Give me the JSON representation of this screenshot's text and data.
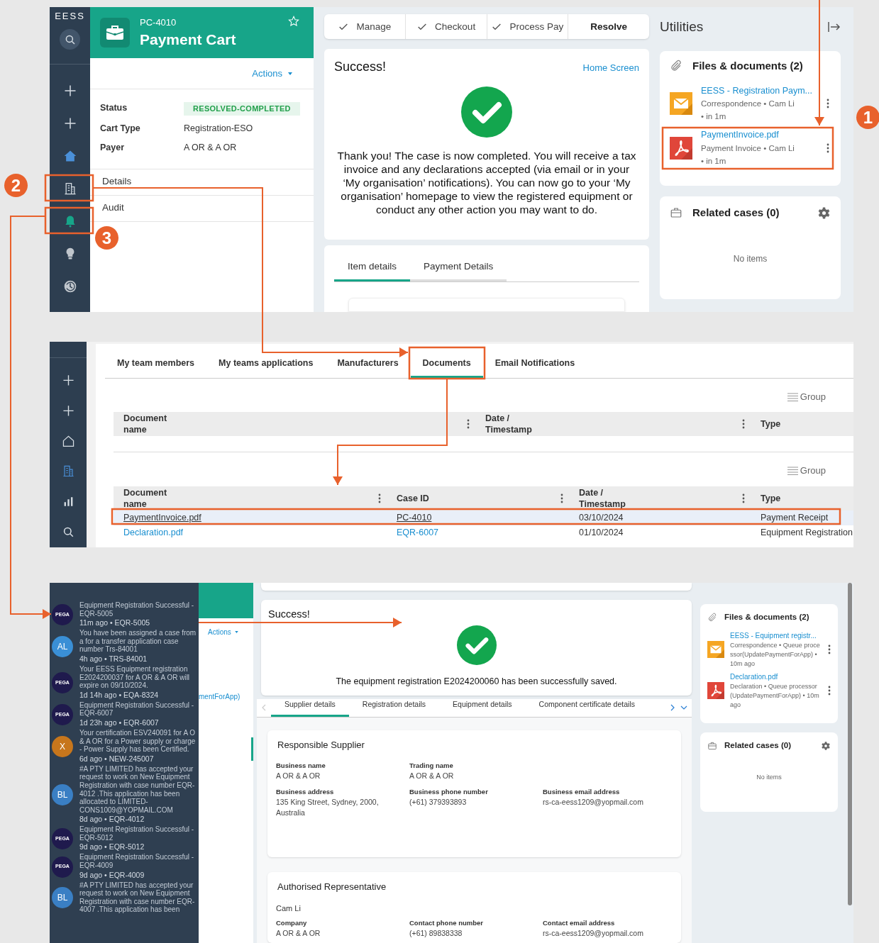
{
  "callouts": [
    "1",
    "2",
    "3"
  ],
  "case_screen": {
    "logo": "EESS",
    "nav": [
      {
        "kind": "search",
        "selected": false
      },
      {
        "kind": "plus",
        "selected": false
      },
      {
        "kind": "plus",
        "selected": false
      },
      {
        "kind": "home",
        "selected": true
      },
      {
        "kind": "building",
        "selected": false
      },
      {
        "kind": "bell",
        "selected": false
      },
      {
        "kind": "bulb",
        "selected": false
      },
      {
        "kind": "history",
        "selected": false
      }
    ],
    "header": {
      "case_id": "PC-4010",
      "title": "Payment Cart"
    },
    "actions": "Actions",
    "fields": [
      {
        "label": "Status",
        "value": "RESOLVED-COMPLETED",
        "kind": "badge"
      },
      {
        "label": "Cart Type",
        "value": "Registration-ESO",
        "kind": "text"
      },
      {
        "label": "Payer",
        "value": "A OR & A OR",
        "kind": "text"
      }
    ],
    "menu": [
      "Details",
      "Audit"
    ],
    "stages": [
      {
        "label": "Manage",
        "done": true
      },
      {
        "label": "Checkout",
        "done": true
      },
      {
        "label": "Process Pay",
        "done": true
      },
      {
        "label": "Resolve",
        "done": false
      }
    ],
    "success": {
      "title": "Success!",
      "link": "Home Screen",
      "message": "Thank you! The case is now completed. You will receive a tax invoice and any declarations accepted (via email or in your ‘My organisation’ notifications). You can now go to your ‘My organisation’ homepage to view the registered equipment or conduct any other action you may want to do."
    },
    "tabs": [
      {
        "label": "Item details",
        "selected": true
      },
      {
        "label": "Payment Details",
        "selected": false
      }
    ],
    "utilities": {
      "title": "Utilities",
      "files_title": "Files & documents (2)",
      "files": [
        {
          "kind": "mail",
          "name": "EESS - Registration Paym...",
          "meta": "Correspondence • Cam Li • in 1m"
        },
        {
          "kind": "pdf",
          "name": "PaymentInvoice.pdf",
          "meta": "Payment Invoice • Cam Li • in 1m"
        }
      ],
      "related_title": "Related cases (0)",
      "empty": "No items"
    }
  },
  "team_screen": {
    "nav": [
      {
        "kind": "plus",
        "selected": false
      },
      {
        "kind": "plus",
        "selected": false
      },
      {
        "kind": "home",
        "selected": false
      },
      {
        "kind": "building",
        "selected": true
      },
      {
        "kind": "chart",
        "selected": false
      },
      {
        "kind": "search",
        "selected": false
      }
    ],
    "tabs": [
      {
        "label": "My team members",
        "selected": false
      },
      {
        "label": "My teams applications",
        "selected": false
      },
      {
        "label": "Manufacturers",
        "selected": false
      },
      {
        "label": "Documents",
        "selected": true
      },
      {
        "label": "Email Notifications",
        "selected": false
      }
    ],
    "documents_table": {
      "group": "Group",
      "columns": [
        "Document name",
        "Date / Timestamp",
        "Type"
      ]
    },
    "case_documents_table": {
      "group": "Group",
      "columns": [
        "Document name",
        "Case ID",
        "Date / Timestamp",
        "Type"
      ],
      "rows": [
        {
          "selected": true,
          "cells": [
            "PaymentInvoice.pdf",
            "PC-4010",
            "03/10/2024",
            "Payment Receipt"
          ]
        },
        {
          "selected": false,
          "cells": [
            "Declaration.pdf",
            "EQR-6007",
            "01/10/2024",
            "Equipment Registration"
          ]
        }
      ]
    }
  },
  "registration_screen": {
    "notifications": [
      {
        "avatar": "PEGA",
        "color": "#1f1a4d",
        "text": "Equipment Registration Successful - EQR-5005",
        "time": "11m ago • EQR-5005"
      },
      {
        "avatar": "AL",
        "color": "#3a8fd6",
        "text": "You have been assigned a case from a for a transfer application case number Trs-84001",
        "time": "4h ago • TRS-84001"
      },
      {
        "avatar": "PEGA",
        "color": "#1f1a4d",
        "text": "Your EESS Equipment registration E2024200037 for A OR & A OR will expire on 09/10/2024.",
        "time": "1d 14h ago • EQA-8324"
      },
      {
        "avatar": "PEGA",
        "color": "#1f1a4d",
        "text": "Equipment Registration Successful - EQR-6007",
        "time": "1d 23h ago • EQR-6007"
      },
      {
        "avatar": "X",
        "color": "#c7761c",
        "text": "Your certification ESV240091 for A O & A OR for a Power supply or charge - Power Supply has been Certified.",
        "time": "6d ago • NEW-245007"
      },
      {
        "avatar": "BL",
        "color": "#3a7fc4",
        "text": "#A PTY LIMITED has accepted your request to work on New Equipment Registration with case number EQR-4012 .This application has been allocated to LIMITED-CONS1009@YOPMAIL.COM",
        "time": "8d ago • EQR-4012"
      },
      {
        "avatar": "PEGA",
        "color": "#1f1a4d",
        "text": "Equipment Registration Successful - EQR-5012",
        "time": "9d ago • EQR-5012"
      },
      {
        "avatar": "PEGA",
        "color": "#1f1a4d",
        "text": "Equipment Registration Successful - EQR-4009",
        "time": "9d ago • EQR-4009"
      },
      {
        "avatar": "BL",
        "color": "#3a7fc4",
        "text": "#A PTY LIMITED has accepted your request to work on New Equipment Registration with case number EQR-4007 .This application has been"
      }
    ],
    "background": {
      "actions": "Actions",
      "fragment": "mentForApp)"
    },
    "success": {
      "title": "Success!",
      "message": "The equipment registration E2024200060 has been successfully saved."
    },
    "tabs": [
      {
        "label": "Supplier details",
        "selected": true
      },
      {
        "label": "Registration details",
        "selected": false
      },
      {
        "label": "Equipment details",
        "selected": false
      },
      {
        "label": "Component certificate details",
        "selected": false
      }
    ],
    "sections": [
      {
        "title": "Responsible Supplier",
        "rows": [
          [
            {
              "label": "Business name",
              "value": "A OR & A OR"
            },
            {
              "label": "Trading name",
              "value": "A OR & A OR"
            }
          ],
          [
            {
              "label": "Business address",
              "value": "135 King Street, Sydney, 2000, Australia"
            },
            {
              "label": "Business phone number",
              "value": "(+61) 379393893"
            },
            {
              "label": "Business email address",
              "value": "rs-ca-eess1209@yopmail.com"
            }
          ]
        ]
      },
      {
        "title": "Authorised Representative",
        "name": "Cam Li",
        "rows": [
          [
            {
              "label": "Company",
              "value": "A OR & A OR"
            },
            {
              "label": "Contact phone number",
              "value": "(+61) 89838338"
            },
            {
              "label": "Contact email address",
              "value": "rs-ca-eess1209@yopmail.com"
            }
          ]
        ]
      }
    ],
    "utilities": {
      "files_title": "Files & documents (2)",
      "files": [
        {
          "kind": "mail",
          "name": "EESS - Equipment registr...",
          "meta": "Correspondence • Queue processor(UpdatePaymentForApp) • 10m ago"
        },
        {
          "kind": "pdf",
          "name": "Declaration.pdf",
          "meta": "Declaration • Queue processor(UpdatePaymentForApp) • 10m ago"
        }
      ],
      "related_title": "Related cases (0)",
      "empty": "No items"
    }
  }
}
